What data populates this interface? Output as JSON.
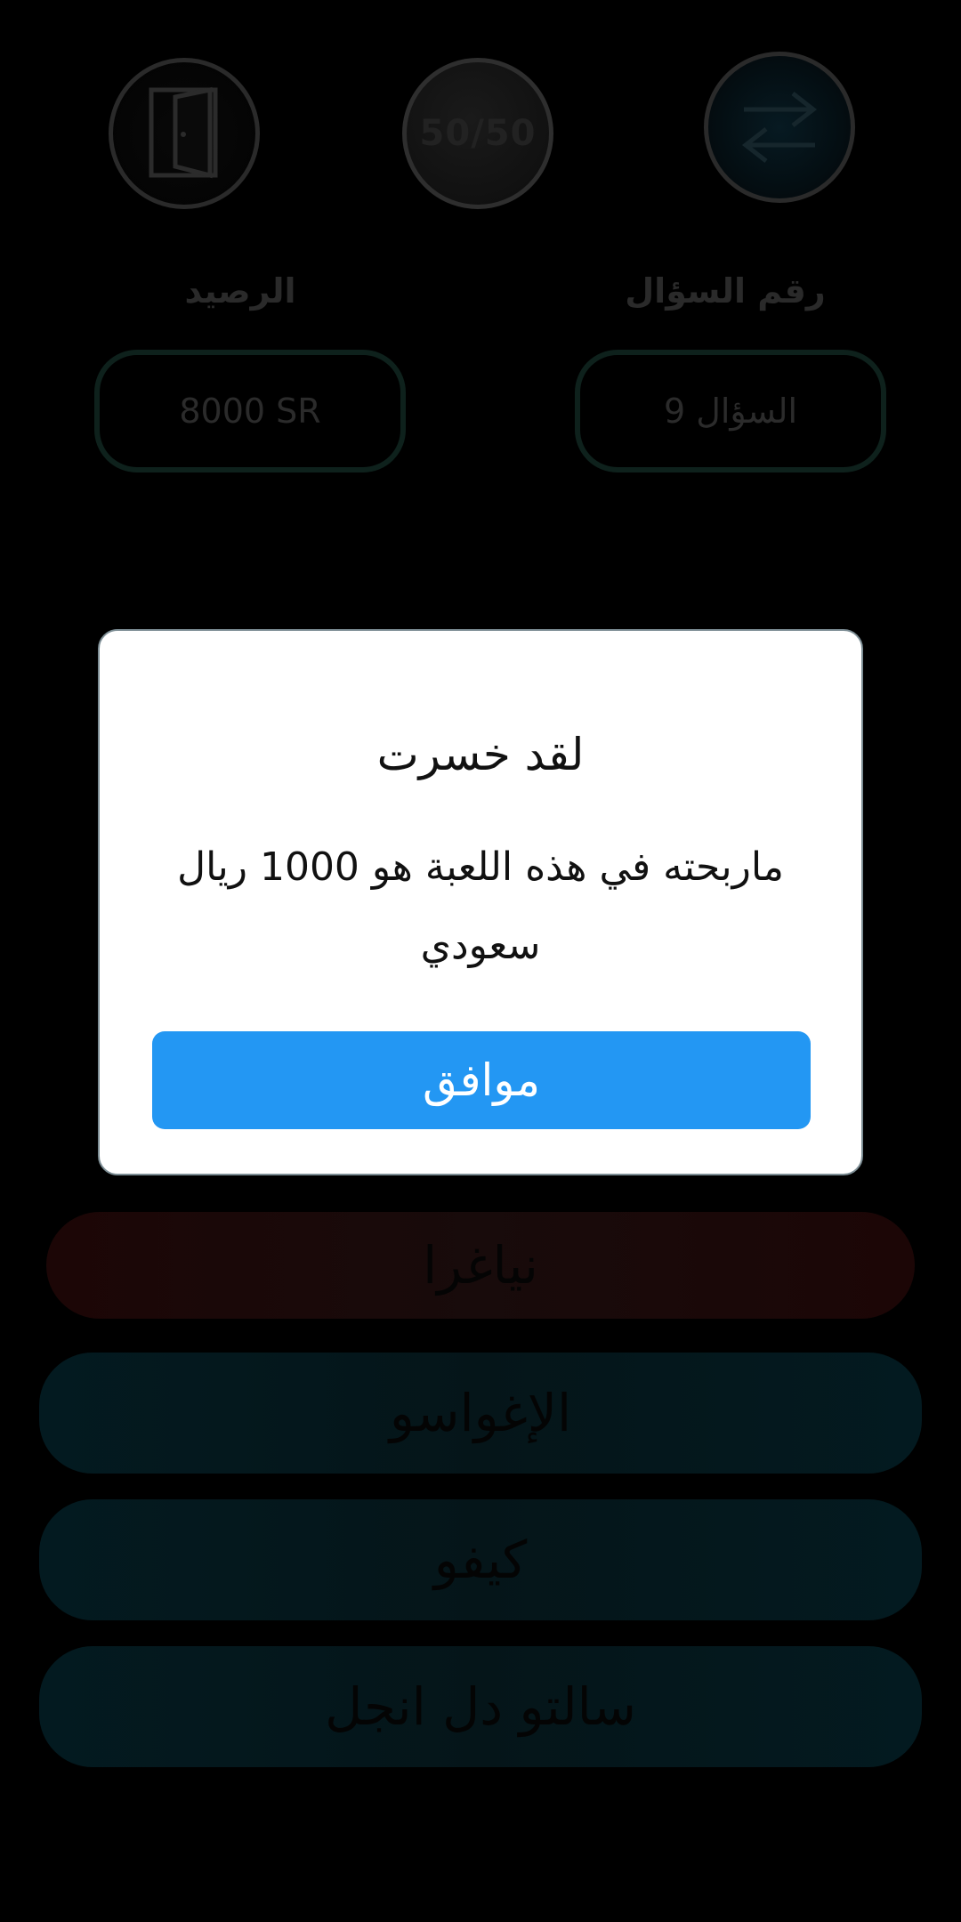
{
  "lifelines": {
    "exit_icon": "door-exit-icon",
    "fifty_label": "50/50",
    "switch_icon": "swap-arrows-icon"
  },
  "stats": {
    "balance_label": "الرصيد",
    "balance_value": "8000 SR",
    "question_label": "رقم السؤال",
    "question_value": "السؤال  9"
  },
  "dialog": {
    "title": "لقد خسرت",
    "message": "ماربحته في هذه اللعبة هو 1000 ريال سعودي",
    "ok_label": "موافق"
  },
  "answers": [
    {
      "label": "نياغرا",
      "state": "wrong"
    },
    {
      "label": "الإغواسو",
      "state": "normal"
    },
    {
      "label": "كيفو",
      "state": "normal"
    },
    {
      "label": "سالتو دل انجل",
      "state": "normal"
    }
  ],
  "colors": {
    "background": "#000000",
    "ok_button": "#2397f3",
    "dialog_bg": "#ffffff",
    "wrong_answer": "#1c0606",
    "normal_answer": "#031a20"
  }
}
